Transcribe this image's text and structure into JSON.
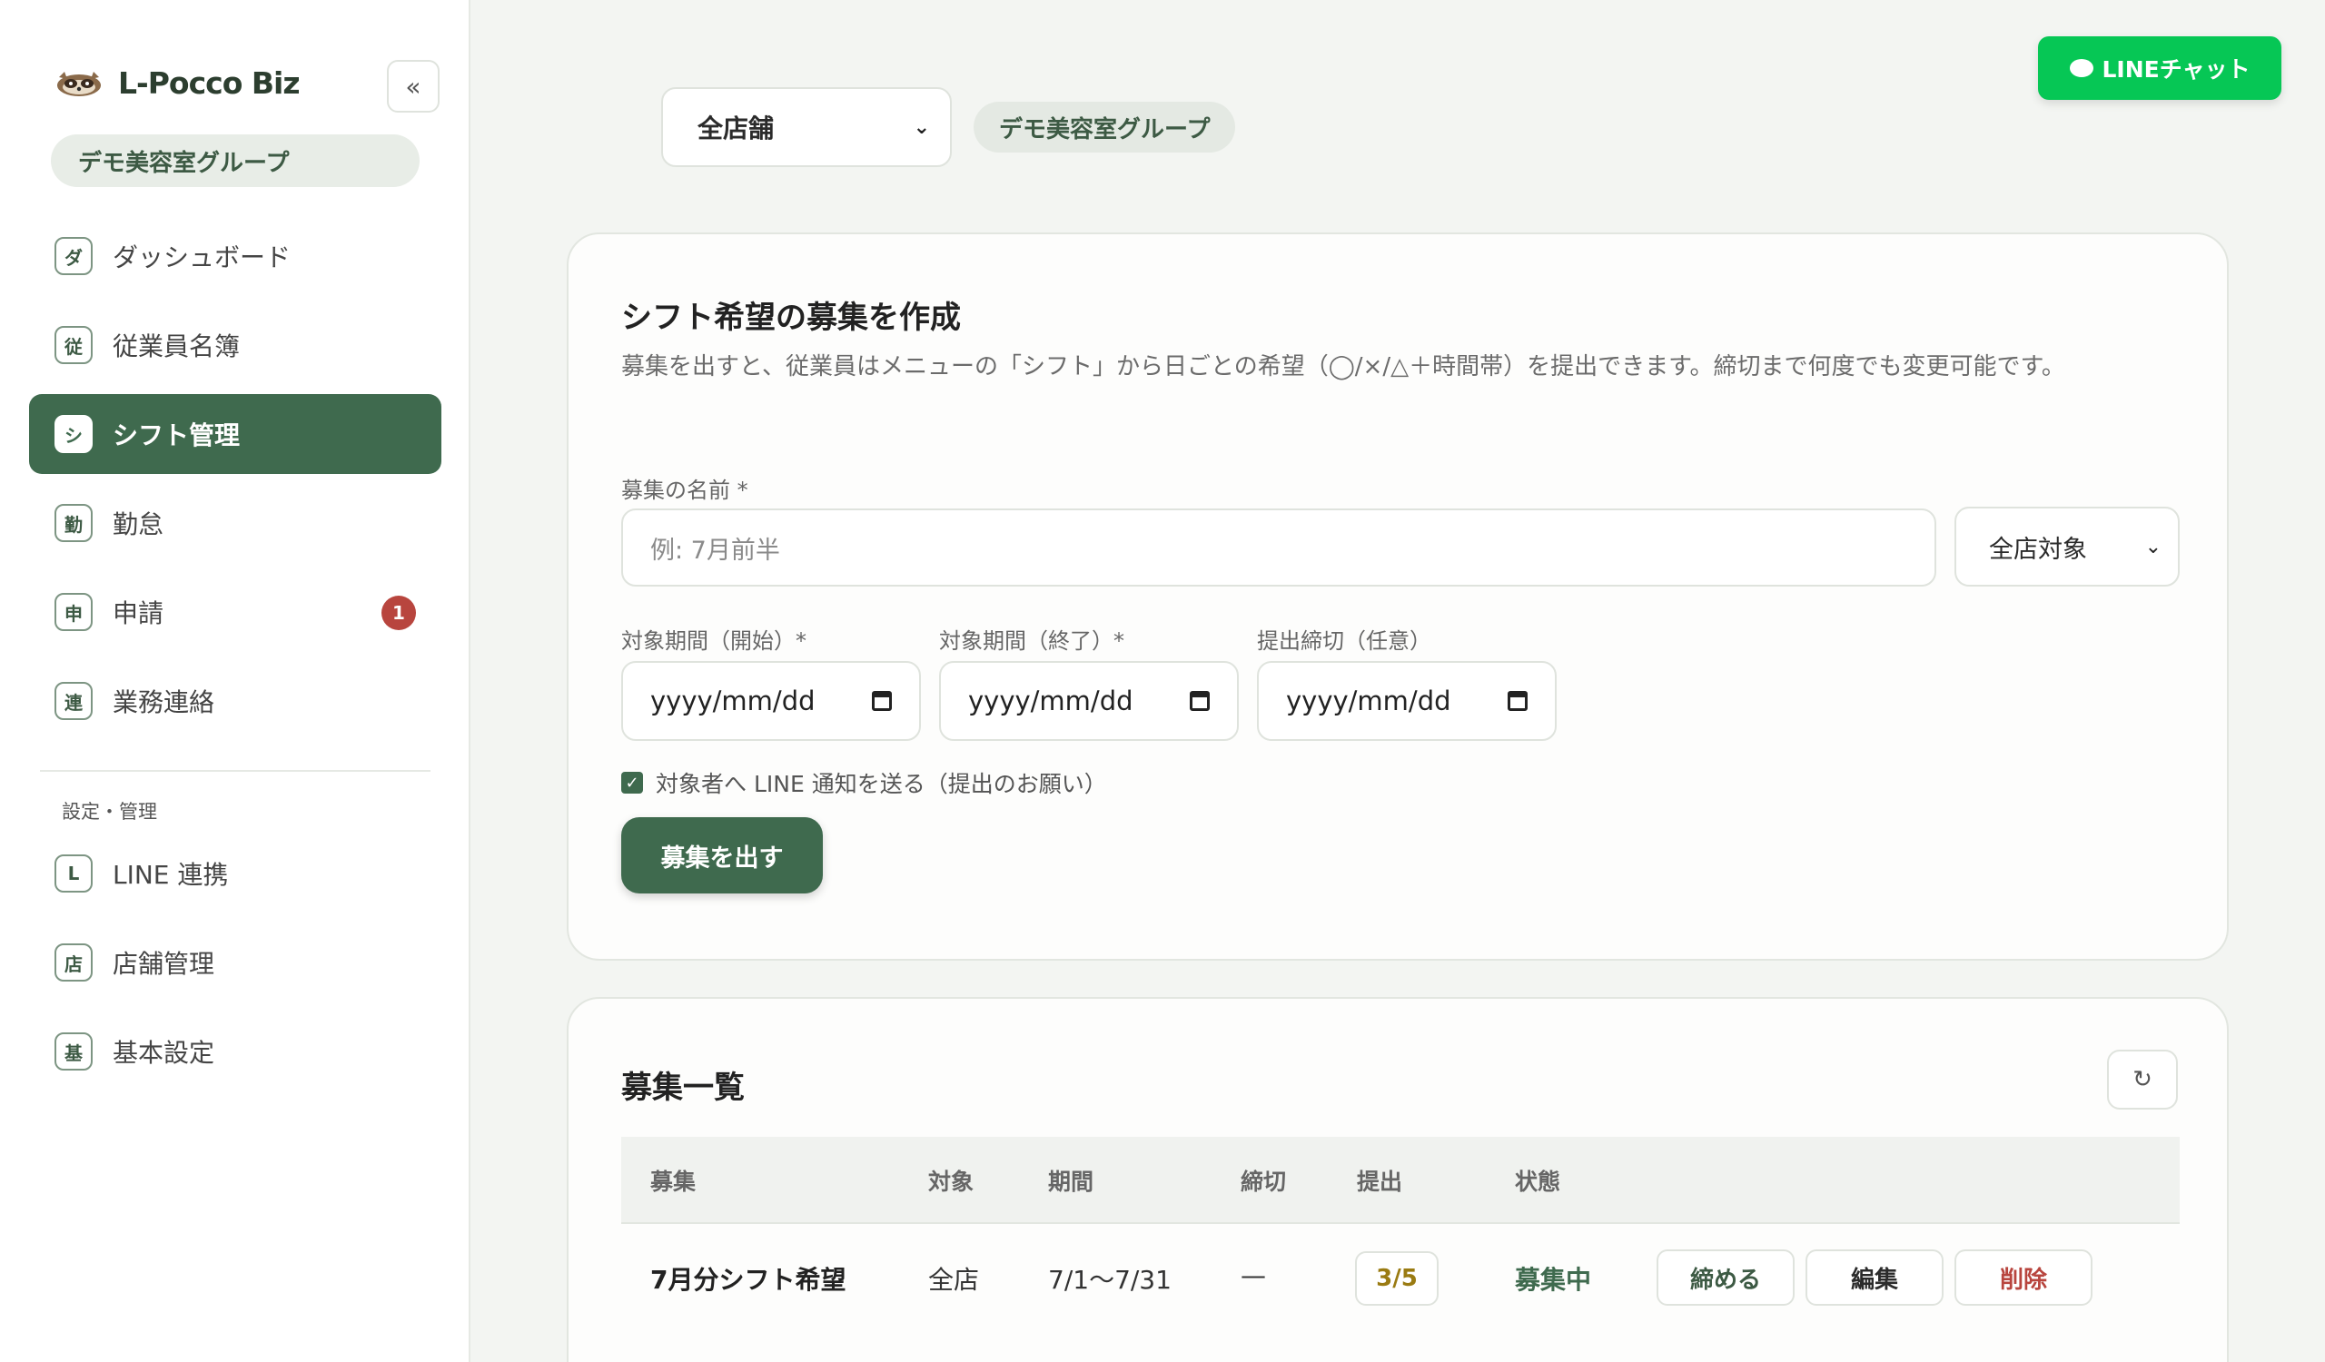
{
  "app": {
    "name": "L-Pocco Biz",
    "org": "デモ美容室グループ",
    "collapse_glyph": "«"
  },
  "sidebar": {
    "items": [
      {
        "icon": "ダ",
        "label": "ダッシュボード",
        "active": false
      },
      {
        "icon": "従",
        "label": "従業員名簿",
        "active": false
      },
      {
        "icon": "シ",
        "label": "シフト管理",
        "active": true
      },
      {
        "icon": "勤",
        "label": "勤怠",
        "active": false
      },
      {
        "icon": "申",
        "label": "申請",
        "active": false,
        "badge": "1"
      },
      {
        "icon": "連",
        "label": "業務連絡",
        "active": false
      }
    ],
    "section_label": "設定・管理",
    "settings_items": [
      {
        "icon": "L",
        "label": "LINE 連携"
      },
      {
        "icon": "店",
        "label": "店舗管理"
      },
      {
        "icon": "基",
        "label": "基本設定"
      }
    ]
  },
  "topbar": {
    "store_select": "全店舗",
    "group_chip": "デモ美容室グループ",
    "line_chat": "LINEチャット"
  },
  "create_card": {
    "title": "シフト希望の募集を作成",
    "description": "募集を出すと、従業員はメニューの「シフト」から日ごとの希望（◯/×/△＋時間帯）を提出できます。締切まで何度でも変更可能です。",
    "name_label": "募集の名前 *",
    "name_placeholder": "例: 7月前半",
    "scope_select": "全店対象",
    "start_label": "対象期間（開始）*",
    "end_label": "対象期間（終了）*",
    "deadline_label": "提出締切（任意）",
    "date_placeholder": "yyyy/mm/dd",
    "notify_label": "対象者へ LINE 通知を送る（提出のお願い）",
    "notify_checked": true,
    "submit_label": "募集を出す"
  },
  "list_card": {
    "title": "募集一覧",
    "refresh_glyph": "↻",
    "columns": [
      "募集",
      "対象",
      "期間",
      "締切",
      "提出",
      "状態"
    ],
    "rows": [
      {
        "name": "7月分シフト希望",
        "target": "全店",
        "period": "7/1〜7/31",
        "deadline": "—",
        "submitted": "3/5",
        "status": "募集中",
        "actions": [
          "締める",
          "編集",
          "削除"
        ]
      }
    ]
  },
  "colors": {
    "accent": "#3f6a4e",
    "line_green": "#06c755",
    "badge_red": "#b8453e",
    "submitted_gold": "#9a7b12"
  }
}
